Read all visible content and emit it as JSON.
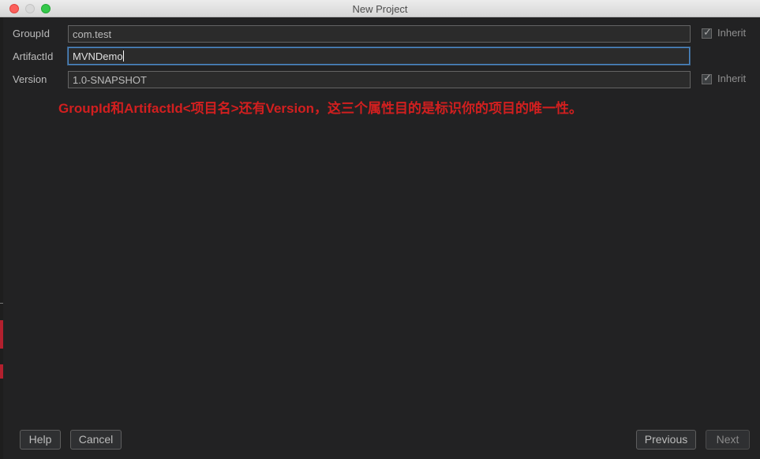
{
  "window": {
    "title": "New Project"
  },
  "form": {
    "group_id": {
      "label": "GroupId",
      "value": "com.test",
      "inherit_label": "Inherit",
      "inherit_checked": true
    },
    "artifact_id": {
      "label": "ArtifactId",
      "value": "MVNDemo"
    },
    "version": {
      "label": "Version",
      "value": "1.0-SNAPSHOT",
      "inherit_label": "Inherit",
      "inherit_checked": true
    }
  },
  "annotation": {
    "text": "GroupId和ArtifactId<项目名>还有Version，这三个属性目的是标识你的项目的唯一性。",
    "color": "#d21f1f"
  },
  "buttons": {
    "help": "Help",
    "cancel": "Cancel",
    "previous": "Previous",
    "next": "Next"
  },
  "colors": {
    "background": "#222223",
    "titlebar": "#e3e3e3",
    "focus_border": "#4a88c7",
    "close": "#fc605c",
    "zoom": "#34c84a"
  }
}
